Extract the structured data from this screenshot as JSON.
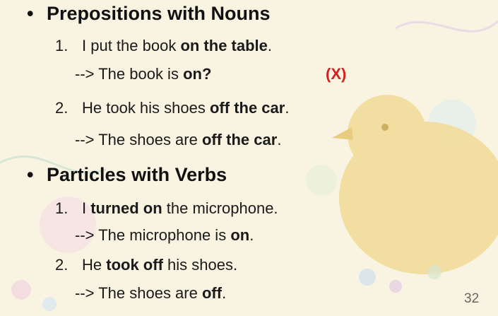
{
  "sections": [
    {
      "bullet": "•",
      "heading": "Prepositions with Nouns",
      "items": [
        {
          "number": "1.",
          "sentence": [
            "I put the book ",
            "on the table",
            "."
          ],
          "result": [
            "--> The book is ",
            "on?"
          ],
          "mark": "(X)"
        },
        {
          "number": "2.",
          "sentence": [
            "He took his shoes ",
            "off the car",
            "."
          ],
          "result": [
            "--> The shoes are ",
            "off the car",
            "."
          ]
        }
      ]
    },
    {
      "bullet": "•",
      "heading": "Particles with Verbs",
      "items": [
        {
          "number": "1.",
          "sentence": [
            "I ",
            "turned on",
            " the microphone."
          ],
          "result": [
            "--> The microphone is ",
            "on",
            "."
          ]
        },
        {
          "number": "2.",
          "sentence": [
            "He ",
            "took off",
            " his shoes."
          ],
          "result": [
            "--> The shoes are ",
            "off",
            "."
          ]
        }
      ]
    }
  ],
  "page_number": "32",
  "colors": {
    "background": "#f8f4e1",
    "mark": "#d42020",
    "bird": "#f2dc9a"
  }
}
